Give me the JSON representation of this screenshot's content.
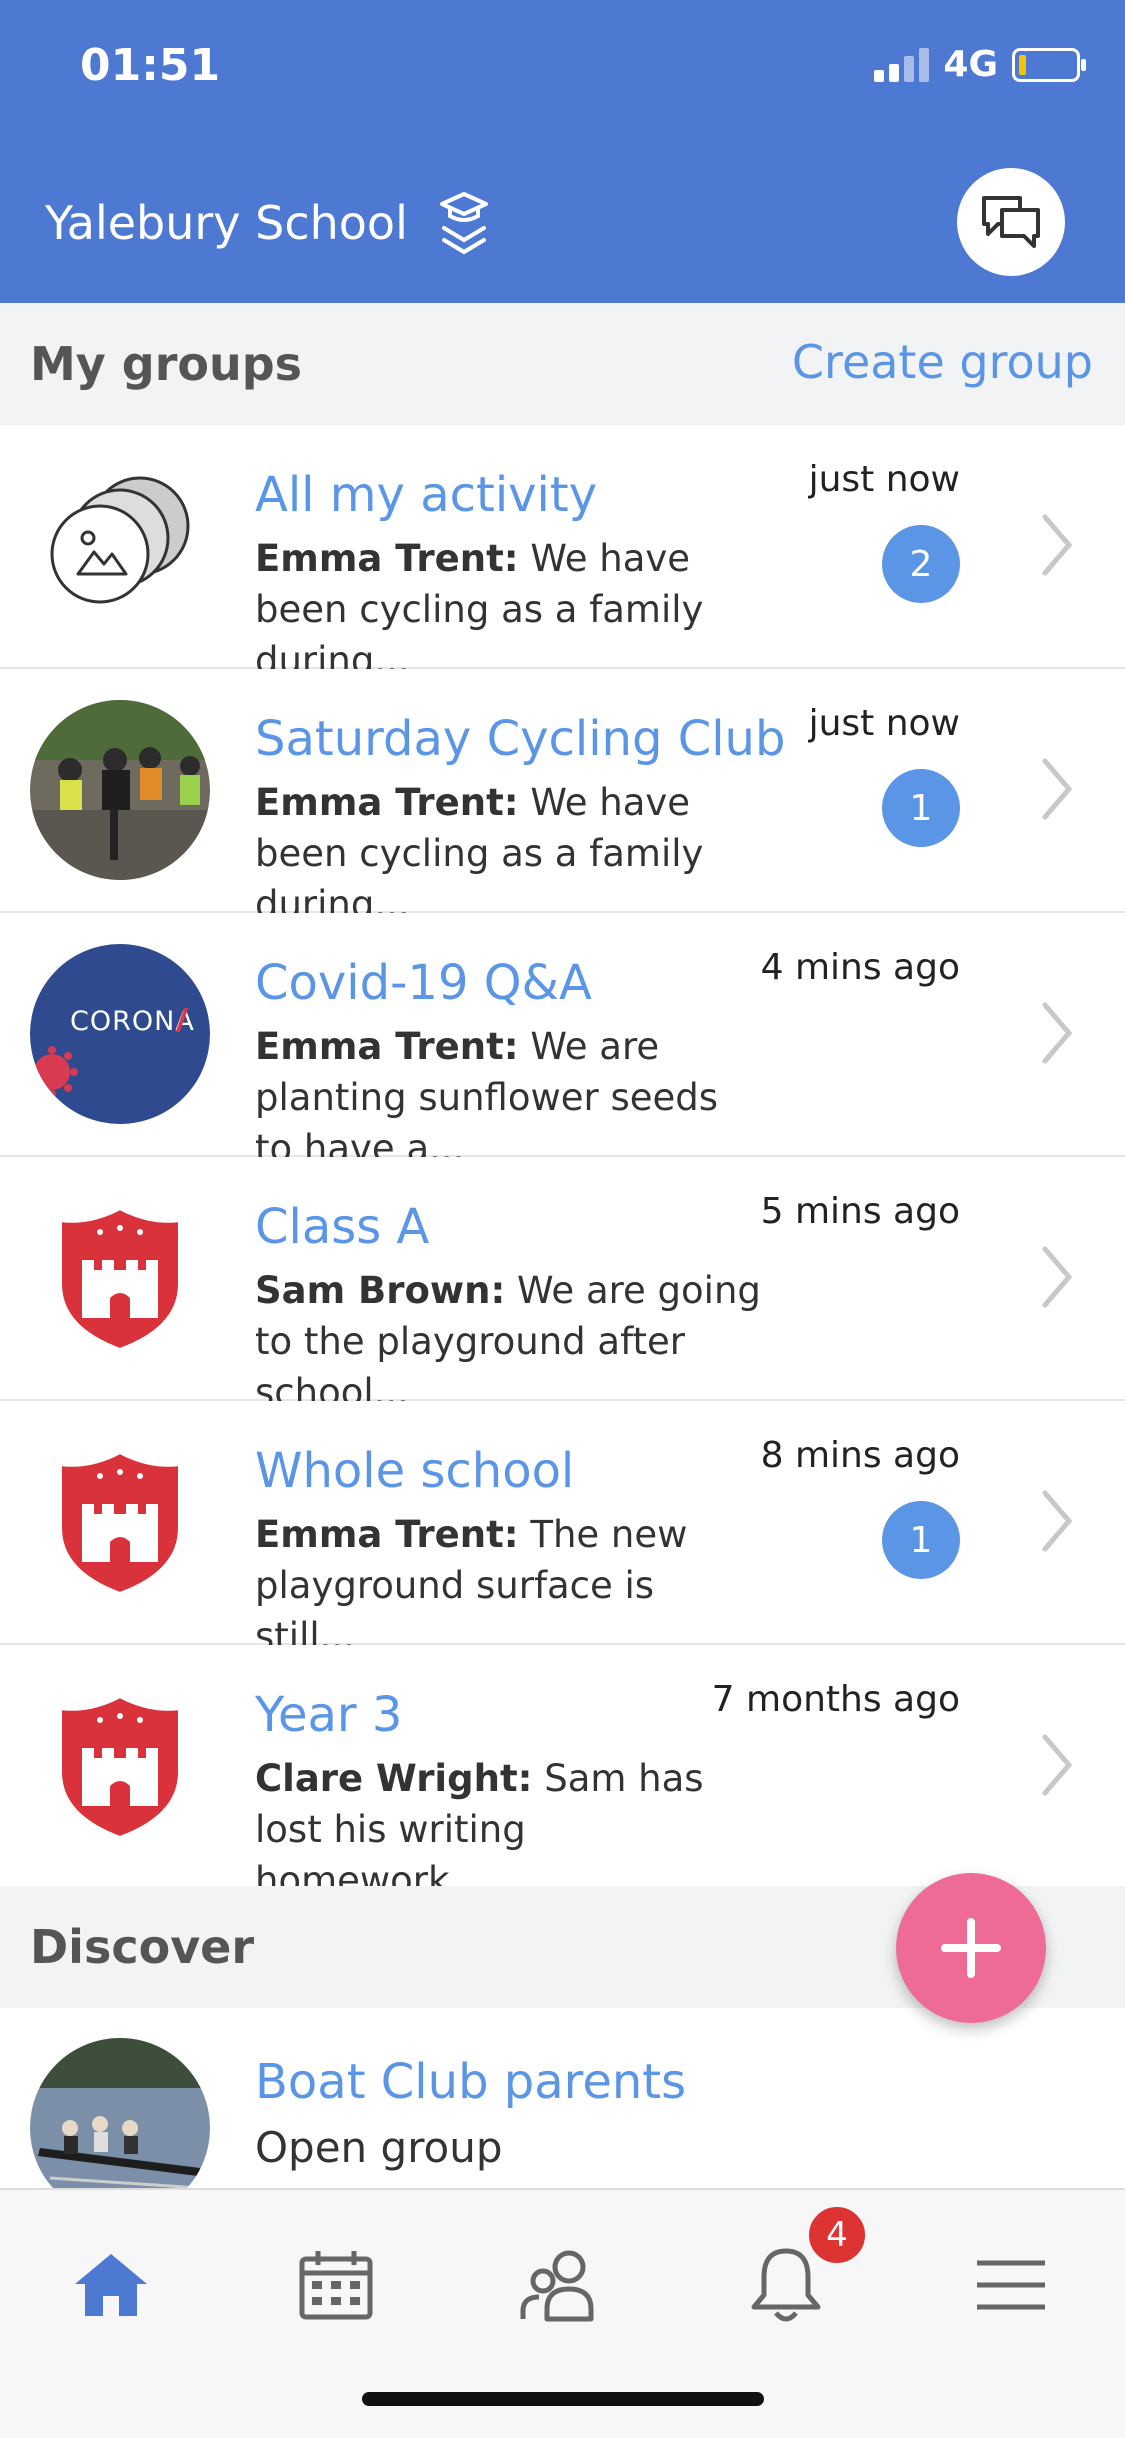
{
  "status_bar": {
    "time": "01:51",
    "network": "4G"
  },
  "header": {
    "school_name": "Yalebury School"
  },
  "my_groups": {
    "title": "My groups",
    "action": "Create group",
    "items": [
      {
        "name": "All my activity",
        "author": "Emma Trent:",
        "message": "We have been cycling as a family during...",
        "time": "just now",
        "badge": "2"
      },
      {
        "name": "Saturday Cycling Club",
        "author": "Emma Trent:",
        "message": "We have been cycling as a family during...",
        "time": "just now",
        "badge": "1"
      },
      {
        "name": "Covid-19 Q&A",
        "author": "Emma Trent:",
        "message": "We are planting sunflower seeds to have a...",
        "time": "4 mins ago",
        "badge": null,
        "avatar_text": "CORONA"
      },
      {
        "name": "Class A",
        "author": "Sam Brown:",
        "message": "We are going to the playground after school...",
        "time": "5 mins ago",
        "badge": null
      },
      {
        "name": "Whole school",
        "author": "Emma Trent:",
        "message": "The new playground surface is still...",
        "time": "8 mins ago",
        "badge": "1"
      },
      {
        "name": "Year 3",
        "author": "Clare Wright:",
        "message": "Sam has lost his writing homework...",
        "time": "7 months ago",
        "badge": null
      }
    ]
  },
  "discover": {
    "title": "Discover",
    "items": [
      {
        "name": "Boat Club parents",
        "subtitle": "Open group"
      }
    ]
  },
  "tabbar": {
    "notifications_count": "4"
  },
  "colors": {
    "header": "#4e79d3",
    "link": "#5b95e6",
    "fab": "#ee6b96",
    "badge_alert": "#dd3333"
  }
}
